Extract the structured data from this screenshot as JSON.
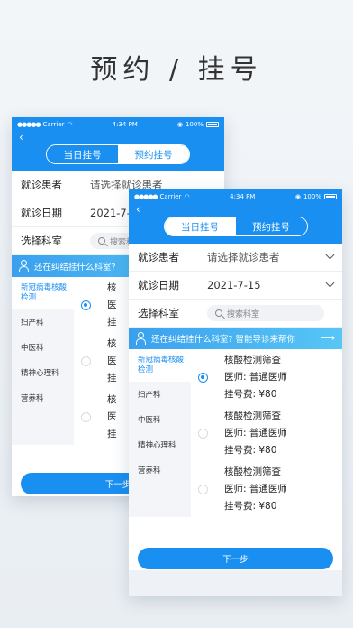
{
  "headline": "预约   /   挂号",
  "status_bar": {
    "carrier": "Carrier",
    "time": "4:34 PM",
    "battery": "100%"
  },
  "tabs": {
    "today": "当日挂号",
    "reserve": "预约挂号"
  },
  "form": {
    "patient_label": "就诊患者",
    "patient_placeholder": "请选择就诊患者",
    "date_label": "就诊日期",
    "date_value": "2021-7-15",
    "dept_label": "选择科室",
    "search_placeholder": "搜索科室"
  },
  "banner": {
    "text": "还在纠结挂什么科室? 智能导诊来帮你",
    "text_short": "还在纠结挂什么科室?"
  },
  "departments": [
    "新冠病毒核酸检测",
    "妇产科",
    "中医科",
    "精神心理科",
    "营养科"
  ],
  "doctors": [
    {
      "name": "核酸检测筛查",
      "doctor": "医师: 普通医师",
      "fee": "挂号费: ¥80",
      "selected": true
    },
    {
      "name": "核酸检测筛查",
      "doctor": "医师: 普通医师",
      "fee": "挂号费: ¥80",
      "selected": false
    },
    {
      "name": "核酸检测筛查",
      "doctor": "医师: 普通医师",
      "fee": "挂号费: ¥80",
      "selected": false
    }
  ],
  "back_preview": {
    "doc_name_fragment": "核",
    "doctor_fragment": "医",
    "fee_fragment": "挂"
  },
  "next_label": "下一步",
  "colors": {
    "primary": "#1a8ff2",
    "banner": "#3aa0ee"
  }
}
